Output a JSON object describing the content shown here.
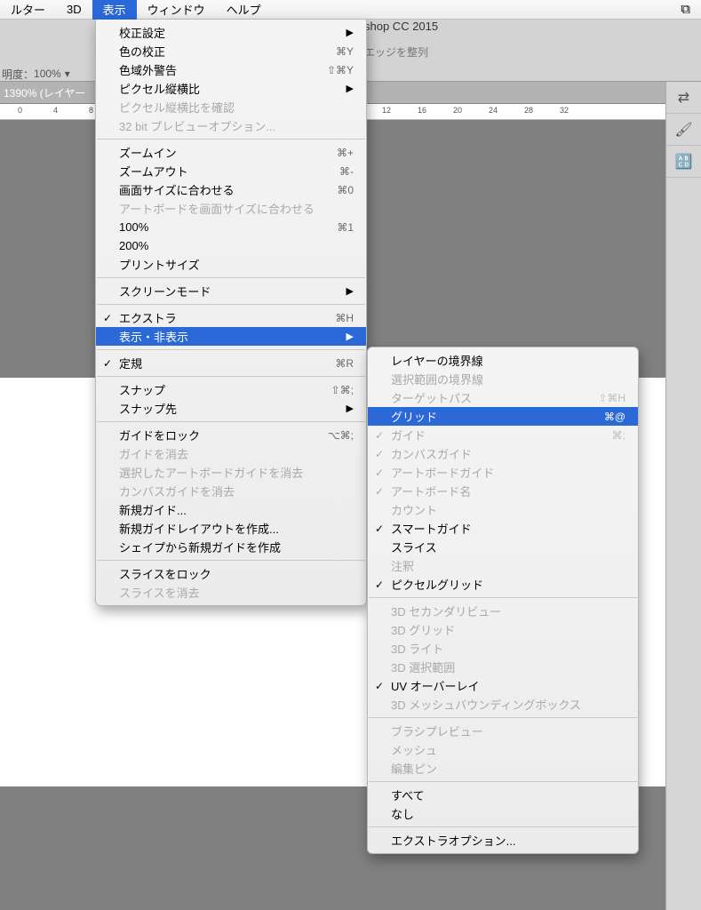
{
  "menubar": {
    "items": [
      "ルター",
      "3D",
      "表示",
      "ウィンドウ",
      "ヘルプ"
    ],
    "active_index": 2
  },
  "app_title": "shop CC 2015",
  "opacity_label": "明度：",
  "opacity_value": "100%",
  "option_text": "エッジを整列",
  "tab_label": "1390% (レイヤー",
  "ruler_ticks": [
    "0",
    "4",
    "8",
    "12",
    "16",
    "20",
    "24",
    "28",
    "32"
  ],
  "ruler_positions": [
    20,
    60,
    100,
    430,
    470,
    510,
    550,
    590,
    630
  ],
  "main_menu": [
    {
      "type": "item",
      "label": "校正設定",
      "arrow": true
    },
    {
      "type": "item",
      "label": "色の校正",
      "shortcut": "⌘Y"
    },
    {
      "type": "item",
      "label": "色域外警告",
      "shortcut": "⇧⌘Y"
    },
    {
      "type": "item",
      "label": "ピクセル縦横比",
      "arrow": true
    },
    {
      "type": "item",
      "label": "ピクセル縦横比を確認",
      "disabled": true
    },
    {
      "type": "item",
      "label": "32 bit プレビューオプション...",
      "disabled": true
    },
    {
      "type": "sep"
    },
    {
      "type": "item",
      "label": "ズームイン",
      "shortcut": "⌘+"
    },
    {
      "type": "item",
      "label": "ズームアウト",
      "shortcut": "⌘-"
    },
    {
      "type": "item",
      "label": "画面サイズに合わせる",
      "shortcut": "⌘0"
    },
    {
      "type": "item",
      "label": "アートボードを画面サイズに合わせる",
      "disabled": true
    },
    {
      "type": "item",
      "label": "100%",
      "shortcut": "⌘1"
    },
    {
      "type": "item",
      "label": "200%"
    },
    {
      "type": "item",
      "label": "プリントサイズ"
    },
    {
      "type": "sep"
    },
    {
      "type": "item",
      "label": "スクリーンモード",
      "arrow": true
    },
    {
      "type": "sep"
    },
    {
      "type": "item",
      "label": "エクストラ",
      "check": true,
      "shortcut": "⌘H"
    },
    {
      "type": "item",
      "label": "表示・非表示",
      "highlight": true,
      "arrow": true
    },
    {
      "type": "sep"
    },
    {
      "type": "item",
      "label": "定規",
      "check": true,
      "shortcut": "⌘R"
    },
    {
      "type": "sep"
    },
    {
      "type": "item",
      "label": "スナップ",
      "shortcut": "⇧⌘;"
    },
    {
      "type": "item",
      "label": "スナップ先",
      "arrow": true
    },
    {
      "type": "sep"
    },
    {
      "type": "item",
      "label": "ガイドをロック",
      "shortcut": "⌥⌘;"
    },
    {
      "type": "item",
      "label": "ガイドを消去",
      "disabled": true
    },
    {
      "type": "item",
      "label": "選択したアートボードガイドを消去",
      "disabled": true
    },
    {
      "type": "item",
      "label": "カンバスガイドを消去",
      "disabled": true
    },
    {
      "type": "item",
      "label": "新規ガイド..."
    },
    {
      "type": "item",
      "label": "新規ガイドレイアウトを作成..."
    },
    {
      "type": "item",
      "label": "シェイプから新規ガイドを作成"
    },
    {
      "type": "sep"
    },
    {
      "type": "item",
      "label": "スライスをロック"
    },
    {
      "type": "item",
      "label": "スライスを消去",
      "disabled": true
    }
  ],
  "sub_menu": [
    {
      "type": "item",
      "label": "レイヤーの境界線"
    },
    {
      "type": "item",
      "label": "選択範囲の境界線",
      "disabled": true
    },
    {
      "type": "item",
      "label": "ターゲットパス",
      "disabled": true,
      "shortcut": "⇧⌘H"
    },
    {
      "type": "item",
      "label": "グリッド",
      "highlight": true,
      "shortcut": "⌘@"
    },
    {
      "type": "item",
      "label": "ガイド",
      "check": true,
      "disabled": true,
      "shortcut": "⌘;"
    },
    {
      "type": "item",
      "label": "カンバスガイド",
      "check": true,
      "disabled": true
    },
    {
      "type": "item",
      "label": "アートボードガイド",
      "check": true,
      "disabled": true
    },
    {
      "type": "item",
      "label": "アートボード名",
      "check": true,
      "disabled": true
    },
    {
      "type": "item",
      "label": "カウント",
      "disabled": true
    },
    {
      "type": "item",
      "label": "スマートガイド",
      "check": true
    },
    {
      "type": "item",
      "label": "スライス"
    },
    {
      "type": "item",
      "label": "注釈",
      "disabled": true
    },
    {
      "type": "item",
      "label": "ピクセルグリッド",
      "check": true
    },
    {
      "type": "sep"
    },
    {
      "type": "item",
      "label": "3D セカンダリビュー",
      "disabled": true
    },
    {
      "type": "item",
      "label": "3D グリッド",
      "disabled": true
    },
    {
      "type": "item",
      "label": "3D ライト",
      "disabled": true
    },
    {
      "type": "item",
      "label": "3D 選択範囲",
      "disabled": true
    },
    {
      "type": "item",
      "label": "UV オーバーレイ",
      "check": true
    },
    {
      "type": "item",
      "label": "3D メッシュバウンディングボックス",
      "disabled": true
    },
    {
      "type": "sep"
    },
    {
      "type": "item",
      "label": "ブラシプレビュー",
      "disabled": true
    },
    {
      "type": "item",
      "label": "メッシュ",
      "disabled": true
    },
    {
      "type": "item",
      "label": "編集ピン",
      "disabled": true
    },
    {
      "type": "sep"
    },
    {
      "type": "item",
      "label": "すべて"
    },
    {
      "type": "item",
      "label": "なし"
    },
    {
      "type": "sep"
    },
    {
      "type": "item",
      "label": "エクストラオプション..."
    }
  ],
  "tools": [
    "⇄",
    "🖌",
    "🔠"
  ]
}
